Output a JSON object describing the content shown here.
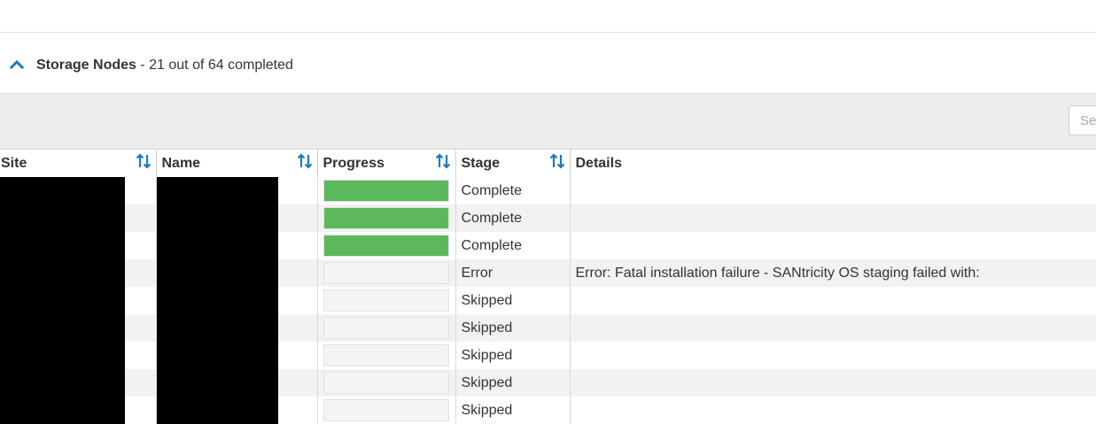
{
  "section": {
    "title": "Storage Nodes",
    "summary": " - 21 out of 64 completed",
    "toggle_icon": "chevron-up-icon",
    "accent_color": "#1a7bc0"
  },
  "search": {
    "placeholder": "Search"
  },
  "table": {
    "columns": [
      {
        "label": "Site",
        "sortable": true
      },
      {
        "label": "Name",
        "sortable": true
      },
      {
        "label": "Progress",
        "sortable": true
      },
      {
        "label": "Stage",
        "sortable": true
      },
      {
        "label": "Details",
        "sortable": false
      }
    ],
    "progress_color": "#5cb85c",
    "rows": [
      {
        "site": "",
        "name": "",
        "progress": 1.0,
        "stage": "Complete",
        "details": ""
      },
      {
        "site": "",
        "name": "",
        "progress": 1.0,
        "stage": "Complete",
        "details": ""
      },
      {
        "site": "",
        "name": "",
        "progress": 1.0,
        "stage": "Complete",
        "details": ""
      },
      {
        "site": "",
        "name": "",
        "progress": 0.0,
        "stage": "Error",
        "details": "Error: Fatal installation failure - SANtricity OS staging failed with:"
      },
      {
        "site": "",
        "name": "",
        "progress": 0.0,
        "stage": "Skipped",
        "details": ""
      },
      {
        "site": "",
        "name": "",
        "progress": 0.0,
        "stage": "Skipped",
        "details": ""
      },
      {
        "site": "",
        "name": "",
        "progress": 0.0,
        "stage": "Skipped",
        "details": ""
      },
      {
        "site": "",
        "name": "",
        "progress": 0.0,
        "stage": "Skipped",
        "details": ""
      },
      {
        "site": "",
        "name": "",
        "progress": 0.0,
        "stage": "Skipped",
        "details": ""
      }
    ]
  }
}
